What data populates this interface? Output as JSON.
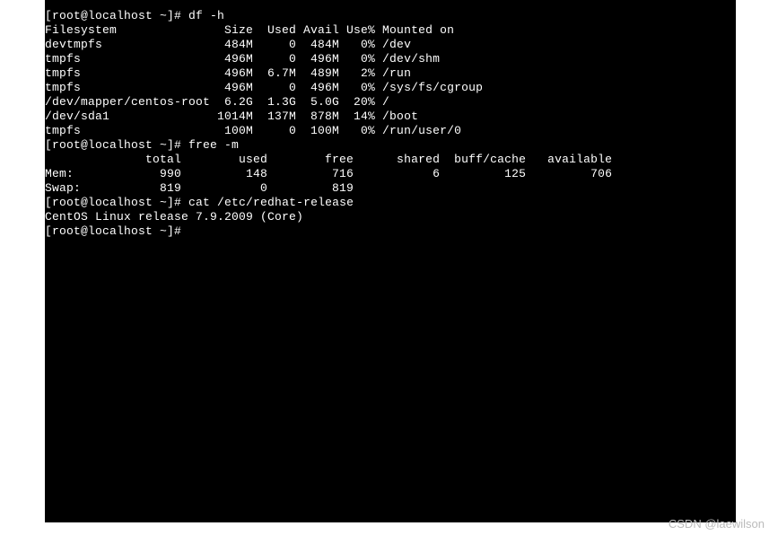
{
  "prompt": "[root@localhost ~]#",
  "commands": {
    "df": "df -h",
    "free": "free -m",
    "cat": "cat /etc/redhat-release"
  },
  "df_header": "Filesystem               Size  Used Avail Use% Mounted on",
  "df_rows": [
    "devtmpfs                 484M     0  484M   0% /dev",
    "tmpfs                    496M     0  496M   0% /dev/shm",
    "tmpfs                    496M  6.7M  489M   2% /run",
    "tmpfs                    496M     0  496M   0% /sys/fs/cgroup",
    "/dev/mapper/centos-root  6.2G  1.3G  5.0G  20% /",
    "/dev/sda1               1014M  137M  878M  14% /boot",
    "tmpfs                    100M     0  100M   0% /run/user/0"
  ],
  "free_header": "              total        used        free      shared  buff/cache   available",
  "free_rows": [
    "Mem:            990         148         716           6         125         706",
    "Swap:           819           0         819"
  ],
  "release": "CentOS Linux release 7.9.2009 (Core)",
  "watermark": "CSDN @laewilson"
}
